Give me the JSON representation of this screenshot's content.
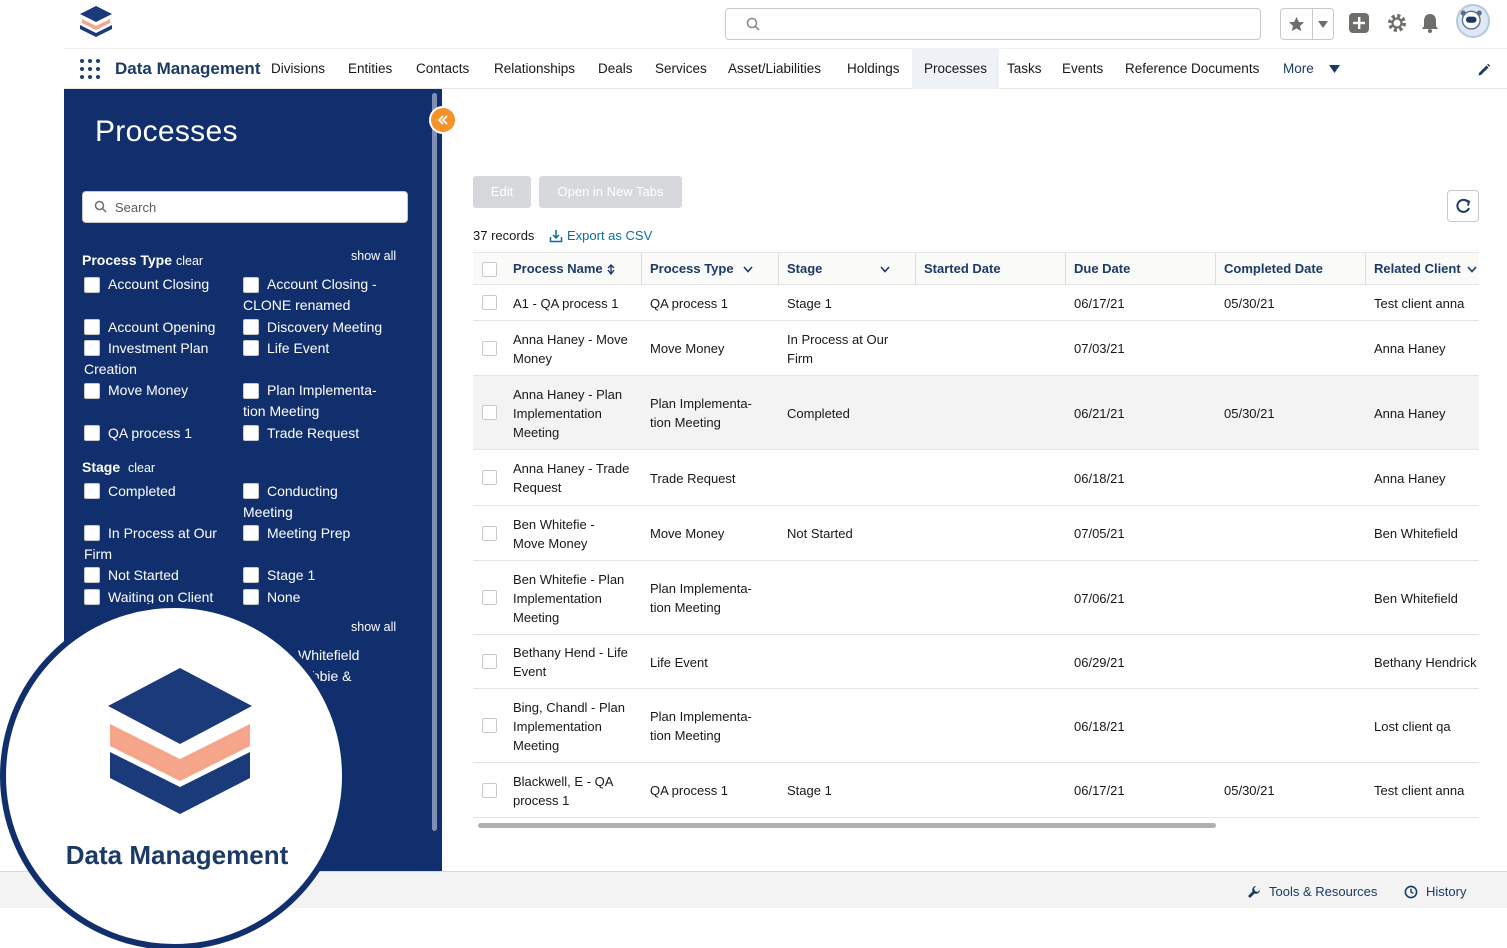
{
  "header": {
    "search_placeholder": ""
  },
  "nav": {
    "app_name": "Data Management",
    "items": [
      "Divisions",
      "Entities",
      "Contacts",
      "Relationships",
      "Deals",
      "Services",
      "Asset/Liabilities",
      "Holdings",
      "Processes",
      "Tasks",
      "Events",
      "Reference Documents"
    ],
    "more_label": "More",
    "active": "Processes"
  },
  "sidebar": {
    "title": "Processes",
    "search_placeholder": "Search",
    "process_type_label": "Process Type",
    "clear_label": "clear",
    "show_all_label": "show all",
    "process_types": {
      "account_closing": "Account Closing",
      "account_closing_clone_1": "Account Closing -",
      "account_closing_clone_2": "CLONE renamed",
      "account_opening": "Account Opening",
      "discovery_meeting": "Discovery Meeting",
      "investment_plan_1": "Investment Plan",
      "investment_plan_2": "Creation",
      "life_event": "Life Event",
      "move_money": "Move Money",
      "plan_impl_1": "Plan Implementa-",
      "plan_impl_2": "tion Meeting",
      "qa_process": "QA process 1",
      "trade_request": "Trade Request"
    },
    "stage_label": "Stage",
    "stages": {
      "completed": "Completed",
      "conducting_1": "Conducting",
      "conducting_2": "Meeting",
      "in_process_1": "In Process at Our",
      "in_process_2": "Firm",
      "meeting_prep": "Meeting Prep",
      "not_started": "Not Started",
      "stage_1": "Stage 1",
      "waiting": "Waiting on Client",
      "none": "None"
    },
    "show_all_2": "show all",
    "partial_1": "Whitefield",
    "partial_2": "ebbie &"
  },
  "toolbar": {
    "edit_label": "Edit",
    "open_tabs_label": "Open in New Tabs",
    "records_label": "37 records",
    "export_label": "Export as CSV"
  },
  "table": {
    "columns": [
      "Process Name",
      "Process Type",
      "Stage",
      "Started Date",
      "Due Date",
      "Completed Date",
      "Related Client"
    ],
    "rows": [
      {
        "name": [
          "A1 - QA process 1"
        ],
        "type": [
          "QA process 1"
        ],
        "stage": [
          "Stage 1"
        ],
        "started": "",
        "due": "06/17/21",
        "completed": "05/30/21",
        "client": "Test client anna"
      },
      {
        "name": [
          "Anna Haney - Move",
          "Money"
        ],
        "type": [
          "Move Money"
        ],
        "stage": [
          "In Process at Our",
          "Firm"
        ],
        "started": "",
        "due": "07/03/21",
        "completed": "",
        "client": "Anna Haney"
      },
      {
        "name": [
          "Anna Haney - Plan",
          "Implementation",
          "Meeting"
        ],
        "type": [
          "Plan Implementa-",
          "tion Meeting"
        ],
        "stage": [
          "Completed"
        ],
        "started": "",
        "due": "06/21/21",
        "completed": "05/30/21",
        "client": "Anna Haney"
      },
      {
        "name": [
          "Anna Haney - Trade",
          "Request"
        ],
        "type": [
          "Trade Request"
        ],
        "stage": [],
        "started": "",
        "due": "06/18/21",
        "completed": "",
        "client": "Anna Haney"
      },
      {
        "name": [
          "Ben Whitefie -",
          "Move Money"
        ],
        "type": [
          "Move Money"
        ],
        "stage": [
          "Not Started"
        ],
        "started": "",
        "due": "07/05/21",
        "completed": "",
        "client": "Ben Whitefield"
      },
      {
        "name": [
          "Ben Whitefie - Plan",
          "Implementation",
          "Meeting"
        ],
        "type": [
          "Plan Implementa-",
          "tion Meeting"
        ],
        "stage": [],
        "started": "",
        "due": "07/06/21",
        "completed": "",
        "client": "Ben Whitefield"
      },
      {
        "name": [
          "Bethany Hend - Life",
          "Event"
        ],
        "type": [
          "Life Event"
        ],
        "stage": [],
        "started": "",
        "due": "06/29/21",
        "completed": "",
        "client": "Bethany Hendrick"
      },
      {
        "name": [
          "Bing, Chandl - Plan",
          "Implementation",
          "Meeting"
        ],
        "type": [
          "Plan Implementa-",
          "tion Meeting"
        ],
        "stage": [],
        "started": "",
        "due": "06/18/21",
        "completed": "",
        "client": "Lost client qa"
      },
      {
        "name": [
          "Blackwell, E - QA",
          "process 1"
        ],
        "type": [
          "QA process 1"
        ],
        "stage": [
          "Stage 1"
        ],
        "started": "",
        "due": "06/17/21",
        "completed": "05/30/21",
        "client": "Test client anna"
      }
    ]
  },
  "footer": {
    "tools_label": "Tools & Resources",
    "history_label": "History"
  },
  "badge": {
    "label": "Data Management"
  },
  "colors": {
    "navy": "#112f6d",
    "accent_orange": "#f5932a",
    "salmon": "#f4a58a",
    "link_blue": "#0b6f9e"
  }
}
